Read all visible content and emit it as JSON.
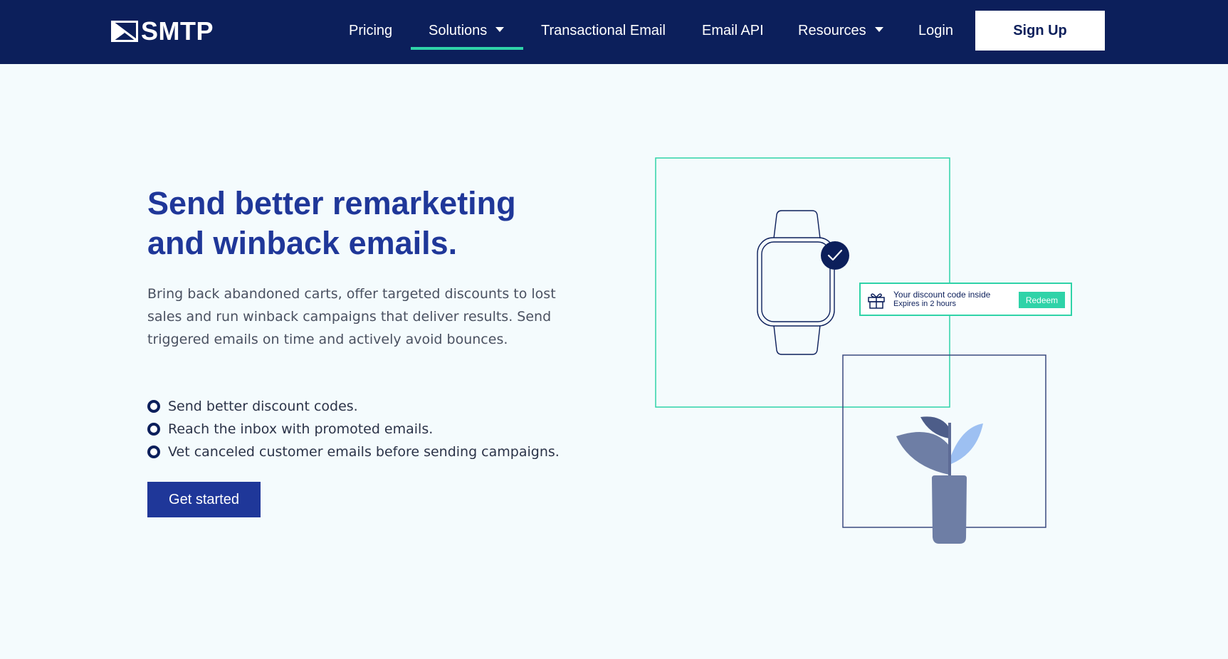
{
  "header": {
    "logo_text": "SMTP",
    "nav": [
      {
        "label": "Pricing"
      },
      {
        "label": "Solutions",
        "dropdown": true,
        "active": true
      },
      {
        "label": "Transactional Email"
      },
      {
        "label": "Email API"
      },
      {
        "label": "Resources",
        "dropdown": true
      },
      {
        "label": "Login"
      }
    ],
    "signup_label": "Sign Up"
  },
  "hero": {
    "title_line1": "Send better remarketing",
    "title_line2": "and winback emails.",
    "description": "Bring back abandoned carts, offer targeted discounts to lost sales and run winback campaigns that deliver results. Send triggered emails on time and actively avoid bounces.",
    "bullets": [
      "Send better discount codes.",
      "Reach the inbox with promoted emails.",
      "Vet canceled customer emails before sending campaigns."
    ],
    "cta_label": "Get started"
  },
  "illustration": {
    "coupon_title": "Your discount code inside",
    "coupon_subtitle": "Expires in 2 hours",
    "redeem_label": "Redeem",
    "icons": [
      "watch-icon",
      "checkmark-icon",
      "gift-icon",
      "plant-icon"
    ]
  },
  "colors": {
    "nav_bg": "#0c1f5b",
    "accent": "#2fd3a8",
    "title": "#1f3799",
    "page_bg": "#f4fbfd"
  }
}
